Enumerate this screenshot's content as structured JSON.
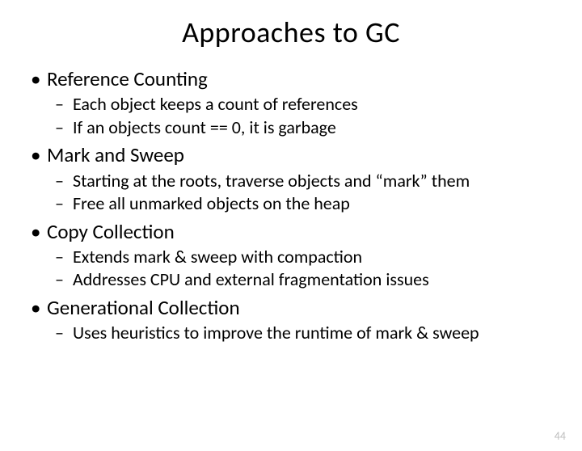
{
  "title": "Approaches to GC",
  "sections": [
    {
      "heading": "Reference Counting",
      "sub": [
        "Each object keeps a count of references",
        "If an objects count == 0, it is garbage"
      ]
    },
    {
      "heading": "Mark and Sweep",
      "sub": [
        "Starting at the roots, traverse objects and “mark” them",
        "Free all unmarked objects on the heap"
      ]
    },
    {
      "heading": "Copy Collection",
      "sub": [
        "Extends mark & sweep with compaction",
        "Addresses CPU and external fragmentation issues"
      ]
    },
    {
      "heading": "Generational Collection",
      "sub": [
        "Uses heuristics to improve the runtime of mark & sweep"
      ]
    }
  ],
  "pageNumber": "44"
}
